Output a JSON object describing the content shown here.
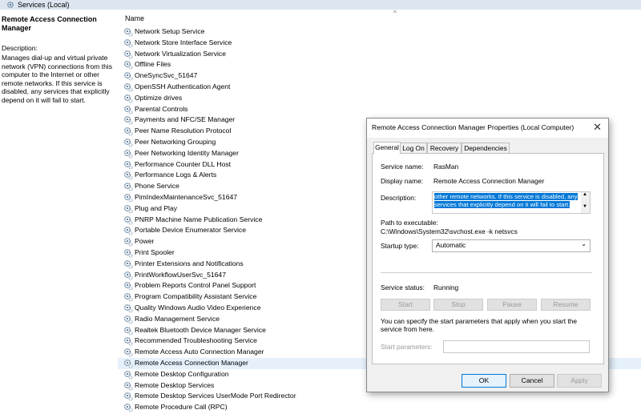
{
  "window": {
    "title": "Services (Local)",
    "icon": "gear-icon"
  },
  "left_pane": {
    "service_title": "Remote Access Connection Manager",
    "description_label": "Description:",
    "description": "Manages dial-up and virtual private network (VPN) connections from this computer to the Internet or other remote networks. If this service is disabled, any services that explicitly depend on it will fail to start."
  },
  "list": {
    "column_header": "Name",
    "sort_indicator": "^",
    "items": [
      "Network Setup Service",
      "Network Store Interface Service",
      "Network Virtualization Service",
      "Offline Files",
      "OneSyncSvc_51647",
      "OpenSSH Authentication Agent",
      "Optimize drives",
      "Parental Controls",
      "Payments and NFC/SE Manager",
      "Peer Name Resolution Protocol",
      "Peer Networking Grouping",
      "Peer Networking Identity Manager",
      "Performance Counter DLL Host",
      "Performance Logs & Alerts",
      "Phone Service",
      "PimIndexMaintenanceSvc_51647",
      "Plug and Play",
      "PNRP Machine Name Publication Service",
      "Portable Device Enumerator Service",
      "Power",
      "Print Spooler",
      "Printer Extensions and Notifications",
      "PrintWorkflowUserSvc_51647",
      "Problem Reports Control Panel Support",
      "Program Compatibility Assistant Service",
      "Quality Windows Audio Video Experience",
      "Radio Management Service",
      "Realtek Bluetooth Device Manager Service",
      "Recommended Troubleshooting Service",
      "Remote Access Auto Connection Manager",
      "Remote Access Connection Manager",
      "Remote Desktop Configuration",
      "Remote Desktop Services",
      "Remote Desktop Services UserMode Port Redirector",
      "Remote Procedure Call (RPC)"
    ],
    "selected_index": 30
  },
  "dialog": {
    "title": "Remote Access Connection Manager Properties (Local Computer)",
    "close": "✕",
    "tabs": [
      "General",
      "Log On",
      "Recovery",
      "Dependencies"
    ],
    "active_tab": "General",
    "service_name_label": "Service name:",
    "service_name": "RasMan",
    "display_name_label": "Display name:",
    "display_name": "Remote Access Connection Manager",
    "description_label": "Description:",
    "description_line1": "other remote networks. If this service is disabled, any",
    "description_line2": "services that explicitly depend on it will fail to start.",
    "path_label": "Path to executable:",
    "path": "C:\\Windows\\System32\\svchost.exe -k netsvcs",
    "startup_type_label": "Startup type:",
    "startup_type": "Automatic",
    "status_label": "Service status:",
    "status": "Running",
    "btn_start": "Start",
    "btn_stop": "Stop",
    "btn_pause": "Pause",
    "btn_resume": "Resume",
    "help_text": "You can specify the start parameters that apply when you start the service from here.",
    "start_params_label": "Start parameters:",
    "ok": "OK",
    "cancel": "Cancel",
    "apply": "Apply"
  },
  "colors": {
    "selection": "#0078d7",
    "selected_row": "#e5f0fb",
    "titlebar": "#dde6f0"
  }
}
